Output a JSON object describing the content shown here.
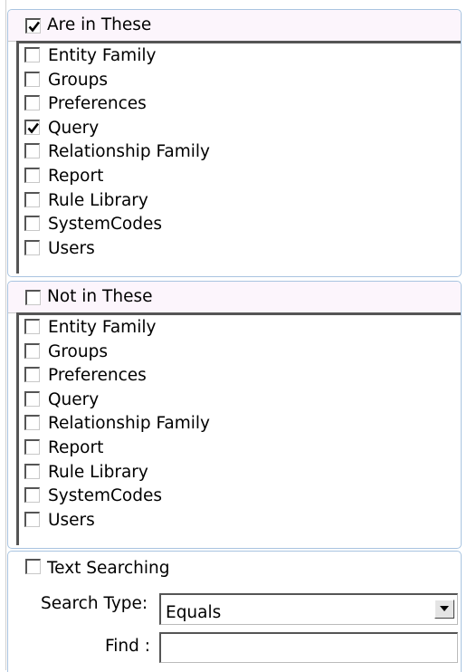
{
  "are_in_these": {
    "label": "Are in These",
    "checked": true,
    "items": [
      {
        "label": "Entity Family",
        "checked": false
      },
      {
        "label": "Groups",
        "checked": false
      },
      {
        "label": "Preferences",
        "checked": false
      },
      {
        "label": "Query",
        "checked": true
      },
      {
        "label": "Relationship Family",
        "checked": false
      },
      {
        "label": "Report",
        "checked": false
      },
      {
        "label": "Rule Library",
        "checked": false
      },
      {
        "label": "SystemCodes",
        "checked": false
      },
      {
        "label": "Users",
        "checked": false
      }
    ]
  },
  "not_in_these": {
    "label": "Not in These",
    "checked": false,
    "items": [
      {
        "label": "Entity Family",
        "checked": false
      },
      {
        "label": "Groups",
        "checked": false
      },
      {
        "label": "Preferences",
        "checked": false
      },
      {
        "label": "Query",
        "checked": false
      },
      {
        "label": "Relationship Family",
        "checked": false
      },
      {
        "label": "Report",
        "checked": false
      },
      {
        "label": "Rule Library",
        "checked": false
      },
      {
        "label": "SystemCodes",
        "checked": false
      },
      {
        "label": "Users",
        "checked": false
      }
    ]
  },
  "text_searching": {
    "label": "Text Searching",
    "checked": false,
    "search_type_label": "Search Type:",
    "search_type_value": "Equals",
    "find_label": "Find :",
    "find_value": ""
  },
  "icons": {
    "checkmark": "checkmark-icon",
    "dropdown": "dropdown-arrow-icon"
  }
}
